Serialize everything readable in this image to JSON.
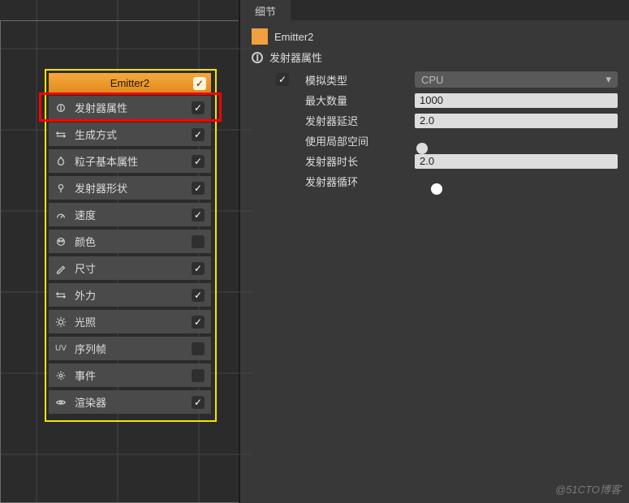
{
  "leftPanel": {
    "emitterHeader": {
      "label": "Emitter2",
      "checked": true
    },
    "modules": [
      {
        "id": "emitter-props",
        "icon": "circle",
        "label": "发射器属性",
        "checked": true
      },
      {
        "id": "spawn",
        "icon": "arrows-h",
        "label": "生成方式",
        "checked": true
      },
      {
        "id": "basic",
        "icon": "flame",
        "label": "粒子基本属性",
        "checked": true
      },
      {
        "id": "shape",
        "icon": "pin",
        "label": "发射器形状",
        "checked": true
      },
      {
        "id": "velocity",
        "icon": "gauge",
        "label": "速度",
        "checked": true
      },
      {
        "id": "color",
        "icon": "palette",
        "label": "颜色",
        "checked": false
      },
      {
        "id": "size",
        "icon": "pencil",
        "label": "尺寸",
        "checked": true
      },
      {
        "id": "force",
        "icon": "arrows-lr",
        "label": "外力",
        "checked": true
      },
      {
        "id": "light",
        "icon": "sun",
        "label": "光照",
        "checked": true
      },
      {
        "id": "uv",
        "icon": "uv",
        "label": "序列帧",
        "checked": false
      },
      {
        "id": "event",
        "icon": "gear",
        "label": "事件",
        "checked": false
      },
      {
        "id": "renderer",
        "icon": "eye",
        "label": "渲染器",
        "checked": true
      }
    ]
  },
  "rightPanel": {
    "tab": "细节",
    "objectName": "Emitter2",
    "sectionTitle": "发射器属性",
    "props": {
      "simType": {
        "label": "模拟类型",
        "value": "CPU",
        "kind": "dropdown"
      },
      "maxCount": {
        "label": "最大数量",
        "value": "1000",
        "kind": "input"
      },
      "delay": {
        "label": "发射器延迟",
        "value": "2.0",
        "kind": "input"
      },
      "localSpace": {
        "label": "使用局部空间",
        "value": false,
        "kind": "switch"
      },
      "duration": {
        "label": "发射器时长",
        "value": "2.0",
        "kind": "input"
      },
      "loop": {
        "label": "发射器循环",
        "value": true,
        "kind": "switch"
      }
    }
  },
  "watermark": "@51CTO博客"
}
